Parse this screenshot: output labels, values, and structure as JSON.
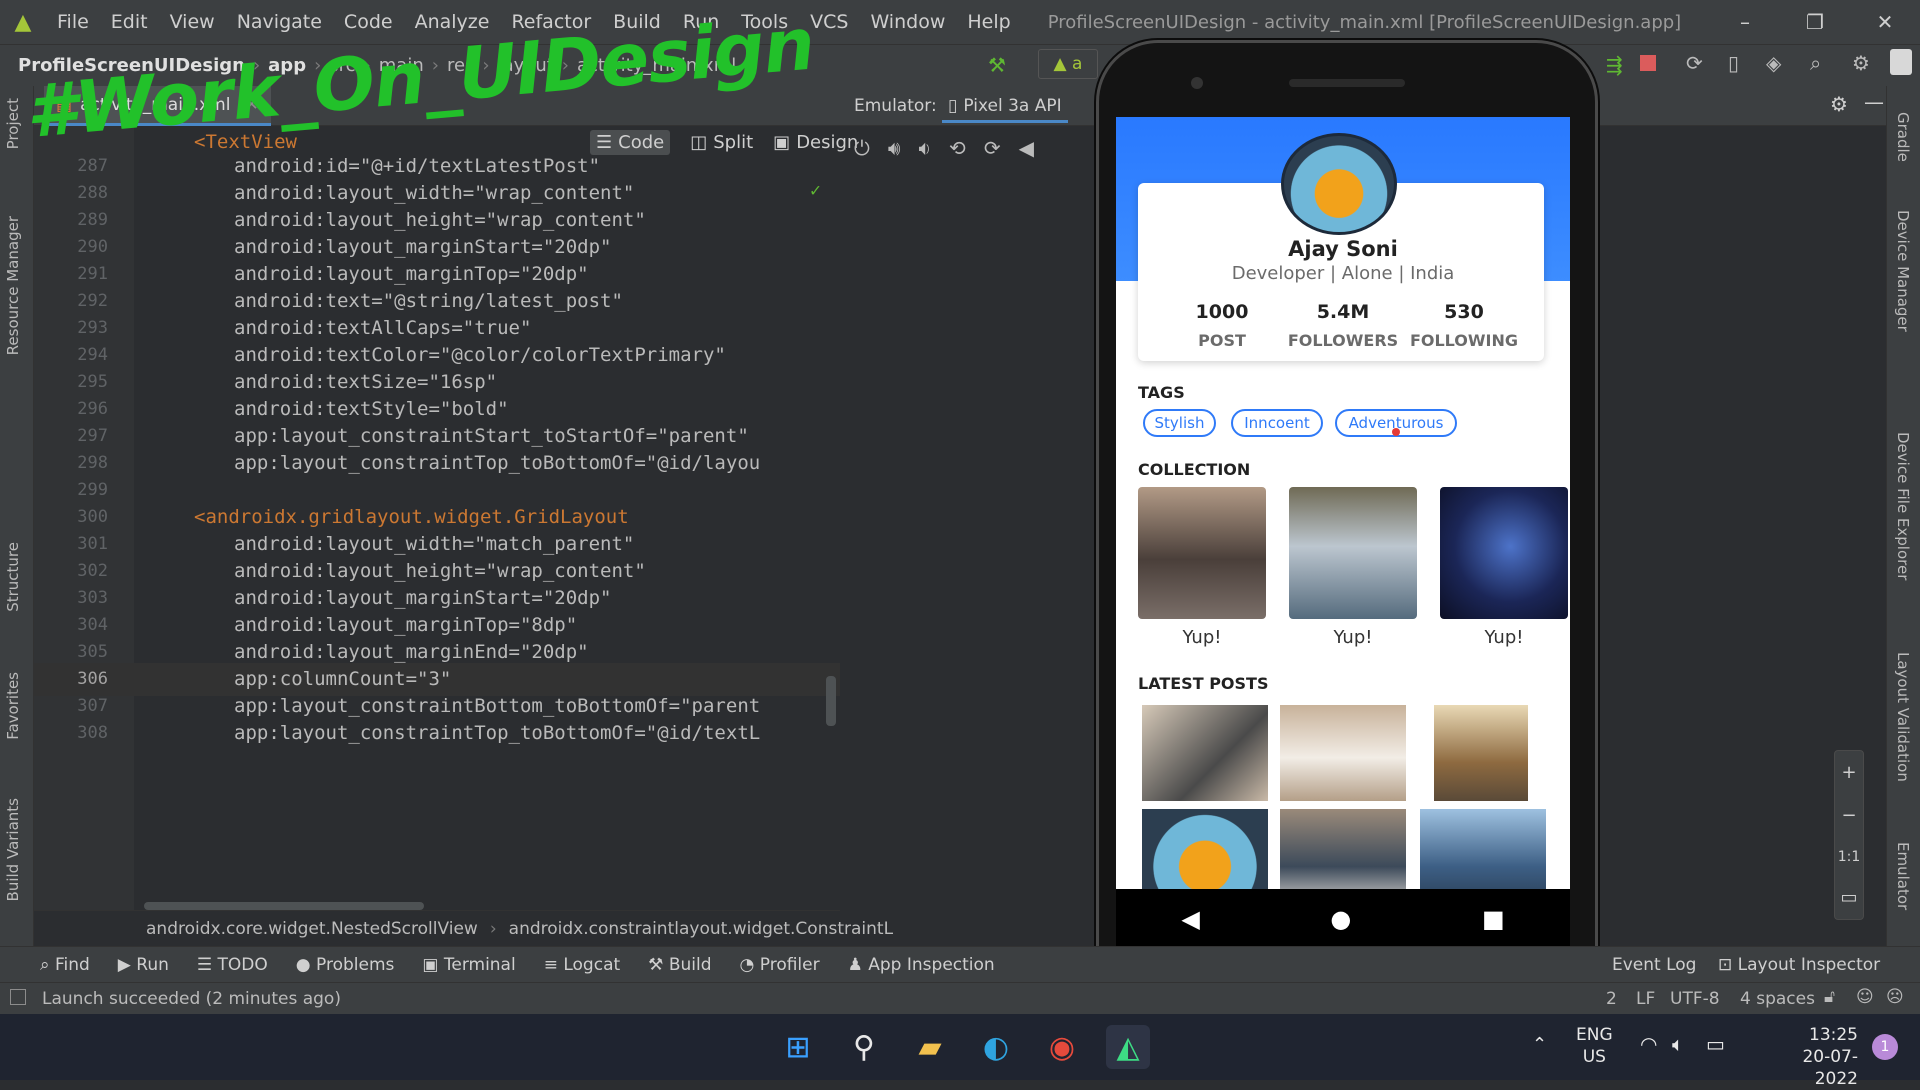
{
  "app": {
    "menu": [
      "File",
      "Edit",
      "View",
      "Navigate",
      "Code",
      "Analyze",
      "Refactor",
      "Build",
      "Run",
      "Tools",
      "VCS",
      "Window",
      "Help"
    ],
    "window_title": "ProfileScreenUIDesign - activity_main.xml [ProfileScreenUIDesign.app]",
    "breadcrumbs": [
      "ProfileScreenUIDesign",
      "app",
      "src",
      "main",
      "res",
      "layout",
      "activity_main.xml"
    ]
  },
  "left_strip": [
    "Project",
    "Resource Manager",
    "Structure",
    "Favorites",
    "Build Variants"
  ],
  "right_strip": [
    "Gradle",
    "Device Manager",
    "Device File Explorer",
    "Layout Validation",
    "Emulator"
  ],
  "editor": {
    "tab": "activity_main.xml",
    "view_modes": [
      "Code",
      "Split",
      "Design"
    ],
    "lines": [
      {
        "n": "",
        "t": "<TextView"
      },
      {
        "n": "287",
        "t": "android:id=\"@+id/textLatestPost\""
      },
      {
        "n": "288",
        "t": "android:layout_width=\"wrap_content\""
      },
      {
        "n": "289",
        "t": "android:layout_height=\"wrap_content\""
      },
      {
        "n": "290",
        "t": "android:layout_marginStart=\"20dp\""
      },
      {
        "n": "291",
        "t": "android:layout_marginTop=\"20dp\""
      },
      {
        "n": "292",
        "t": "android:text=\"@string/latest_post\""
      },
      {
        "n": "293",
        "t": "android:textAllCaps=\"true\""
      },
      {
        "n": "294",
        "t": "android:textColor=\"@color/colorTextPrimary\""
      },
      {
        "n": "295",
        "t": "android:textSize=\"16sp\""
      },
      {
        "n": "296",
        "t": "android:textStyle=\"bold\""
      },
      {
        "n": "297",
        "t": "app:layout_constraintStart_toStartOf=\"parent\""
      },
      {
        "n": "298",
        "t": "app:layout_constraintTop_toBottomOf=\"@id/layou"
      },
      {
        "n": "299",
        "t": ""
      },
      {
        "n": "300",
        "t": "<androidx.gridlayout.widget.GridLayout"
      },
      {
        "n": "301",
        "t": "android:layout_width=\"match_parent\""
      },
      {
        "n": "302",
        "t": "android:layout_height=\"wrap_content\""
      },
      {
        "n": "303",
        "t": "android:layout_marginStart=\"20dp\""
      },
      {
        "n": "304",
        "t": "android:layout_marginTop=\"8dp\""
      },
      {
        "n": "305",
        "t": "android:layout_marginEnd=\"20dp\""
      },
      {
        "n": "306",
        "t": "app:columnCount=\"3\""
      },
      {
        "n": "307",
        "t": "app:layout_constraintBottom_toBottomOf=\"parent"
      },
      {
        "n": "308",
        "t": "app:layout_constraintTop_toBottomOf=\"@id/textL"
      }
    ],
    "current_line": "306",
    "path": [
      "androidx.core.widget.NestedScrollView",
      "androidx.constraintlayout.widget.ConstraintL"
    ]
  },
  "watermark": "#Work_On_UIDesign",
  "emulator": {
    "label": "Emulator:",
    "device": "Pixel 3a API"
  },
  "bottom_tools": [
    "Find",
    "Run",
    "TODO",
    "Problems",
    "Terminal",
    "Logcat",
    "Build",
    "Profiler",
    "App Inspection"
  ],
  "bottom_tools_right": [
    "Event Log",
    "Layout Inspector"
  ],
  "status": {
    "message": "Launch succeeded (2 minutes ago)",
    "right": [
      "2",
      "LF",
      "UTF-8",
      "4 spaces"
    ]
  },
  "profile": {
    "name": "Ajay Soni",
    "subtitle": "Developer | Alone | India",
    "stats": [
      {
        "value": "1000",
        "label": "POST"
      },
      {
        "value": "5.4M",
        "label": "FOLLOWERS"
      },
      {
        "value": "530",
        "label": "FOLLOWING"
      }
    ],
    "tags_title": "TAGS",
    "tags": [
      "Stylish",
      "Inncoent",
      "Adventurous"
    ],
    "collection_title": "COLLECTION",
    "collection_captions": [
      "Yup!",
      "Yup!",
      "Yup!"
    ],
    "latest_title": "LATEST POSTS"
  },
  "taskbar": {
    "lang": "ENG",
    "region": "US",
    "time": "13:25",
    "date": "20-07-2022",
    "notif_count": "1"
  },
  "colors": {
    "accent": "#2f7af8",
    "header_blue": "#2979ff",
    "watermark": "#22c12a"
  }
}
